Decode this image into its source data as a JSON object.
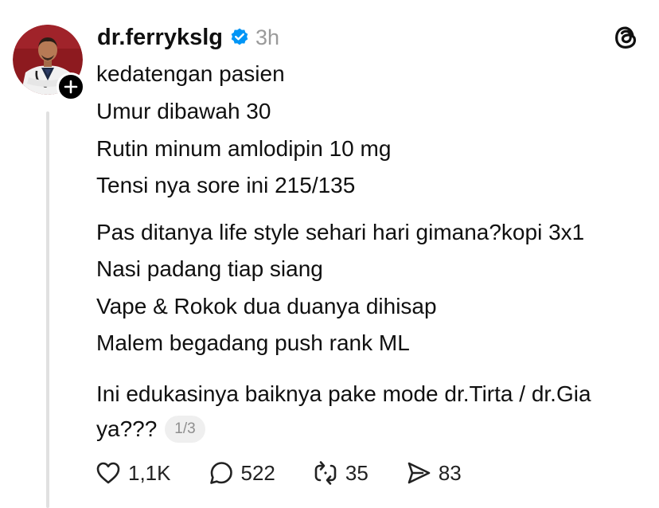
{
  "post": {
    "username": "dr.ferrykslg",
    "time": "3h",
    "lines": [
      "kedatengan pasien",
      "Umur dibawah 30",
      "Rutin minum amlodipin 10 mg",
      "Tensi nya sore ini 215/135",
      "Pas ditanya life style sehari hari gimana?kopi 3x1",
      "Nasi padang tiap siang",
      "Vape & Rokok dua duanya dihisap",
      "Malem begadang push rank ML",
      "Ini edukasinya baiknya pake mode dr.Tirta / dr.Gia",
      "ya???"
    ],
    "page_indicator": "1/3"
  },
  "actions": {
    "likes": "1,1K",
    "replies": "522",
    "reposts": "35",
    "shares": "83"
  },
  "colors": {
    "verified": "#0095f6",
    "muted": "#9a9a9a"
  },
  "icons": [
    "avatar",
    "plus-icon",
    "verified-badge-icon",
    "threads-logo-icon",
    "heart-icon",
    "reply-icon",
    "repost-icon",
    "share-icon"
  ]
}
